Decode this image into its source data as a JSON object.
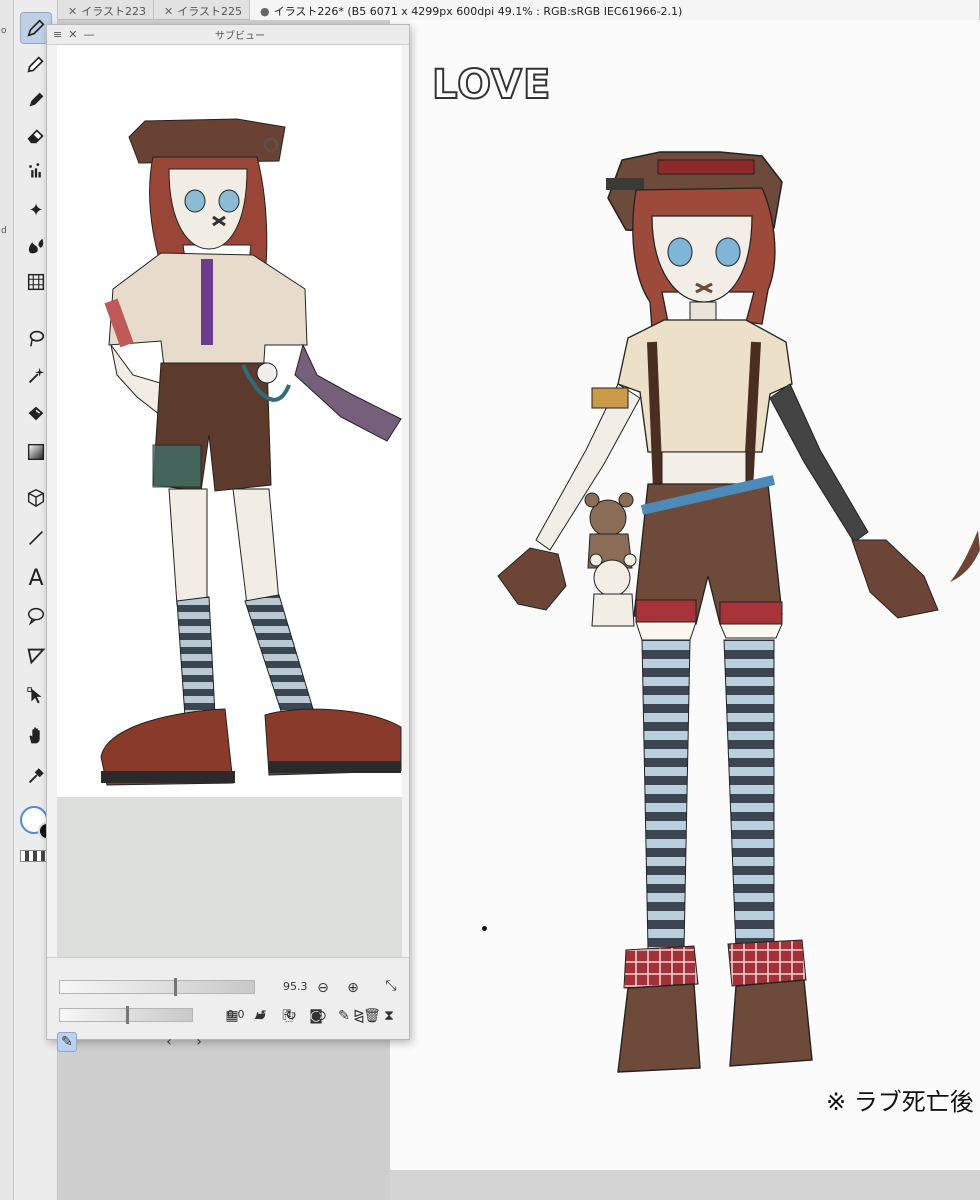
{
  "left_edge": {
    "chars": [
      "o",
      "d"
    ]
  },
  "tabs": [
    {
      "label": "イラスト223",
      "active": false
    },
    {
      "label": "イラスト225",
      "active": false
    },
    {
      "label": "イラスト226* (B5 6071 x 4299px 600dpi 49.1% : RGB:sRGB IEC61966-2.1)",
      "active": true
    }
  ],
  "toolbar": {
    "tools": [
      "pen-icon",
      "pencil-icon",
      "brush-icon",
      "eraser-icon",
      "decoration-icon",
      "sparkle-icon",
      "blend-icon",
      "mesh-icon",
      "lasso-icon",
      "magic-wand-icon",
      "fill-icon",
      "gradient-icon",
      "3d-object-icon",
      "line-icon",
      "text-icon",
      "balloon-icon",
      "frame-icon",
      "object-select-icon",
      "hand-icon",
      "eyedropper-icon"
    ],
    "text_tool": "A"
  },
  "subview": {
    "title": "サブビュー",
    "zoom_value": "95.3",
    "rotation_value": "0.0"
  },
  "canvas": {
    "title_text": "LOVE",
    "note_text": "※ ラブ死亡後"
  },
  "colors": {
    "accent": "#bfd0e6",
    "canvas": "#fbfbfb",
    "panel": "#f2f2f2"
  }
}
